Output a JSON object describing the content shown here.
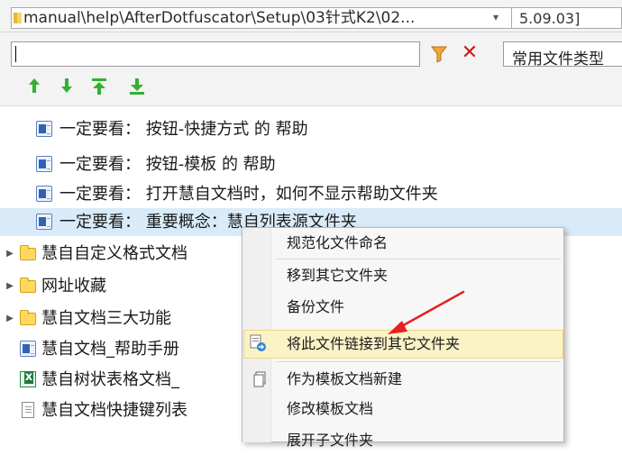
{
  "pathbar": {
    "path": "manual\\help\\AfterDotfuscator\\Setup\\03针式K2\\02...",
    "dropdown": "▾",
    "date": "5.09.03]"
  },
  "search": {
    "value": "",
    "filter_icon": "funnel-icon",
    "clear_icon": "close-icon",
    "clear_glyph": "✕",
    "type_label": "常用文件类型"
  },
  "toolbar": {
    "arrows": [
      "move-up-icon",
      "move-down-icon",
      "move-top-icon",
      "move-bottom-icon"
    ]
  },
  "tree": {
    "items": [
      {
        "label": "一定要看： 按钮-快捷方式 的 帮助",
        "icon": "word-doc-icon"
      },
      {
        "label": "一定要看： 按钮-模板 的 帮助",
        "icon": "word-doc-icon"
      },
      {
        "label": "一定要看： 打开慧自文档时，如何不显示帮助文件夹",
        "icon": "word-doc-icon"
      },
      {
        "label": "一定要看： 重要概念：慧自列表源文件夹",
        "icon": "word-doc-icon",
        "selected": true
      },
      {
        "label": "慧自自定义格式文档",
        "icon": "folder-icon",
        "expandable": true
      },
      {
        "label": "网址收藏",
        "icon": "folder-icon",
        "expandable": true
      },
      {
        "label": "慧自文档三大功能",
        "icon": "folder-icon",
        "expandable": true
      },
      {
        "label": "慧自文档_帮助手册",
        "icon": "word-doc-icon"
      },
      {
        "label": "慧自树状表格文档_",
        "icon": "excel-doc-icon"
      },
      {
        "label": "慧自文档快捷键列表",
        "icon": "text-doc-icon"
      }
    ]
  },
  "context_menu": {
    "items": [
      {
        "label": "规范化文件命名"
      },
      {
        "label": "移到其它文件夹"
      },
      {
        "label": "备份文件"
      },
      {
        "label": "将此文件链接到其它文件夹",
        "highlighted": true,
        "icon": "link-file-icon"
      },
      {
        "label": "作为模板文档新建",
        "icon": "template-icon"
      },
      {
        "label": "修改模板文档"
      },
      {
        "label": "展开子文件夹"
      }
    ]
  },
  "colors": {
    "highlight": "#fbf2c6",
    "selection": "#d9ebf9",
    "annotation_arrow": "#e82020",
    "toolbar_arrow": "#2aa02a"
  }
}
